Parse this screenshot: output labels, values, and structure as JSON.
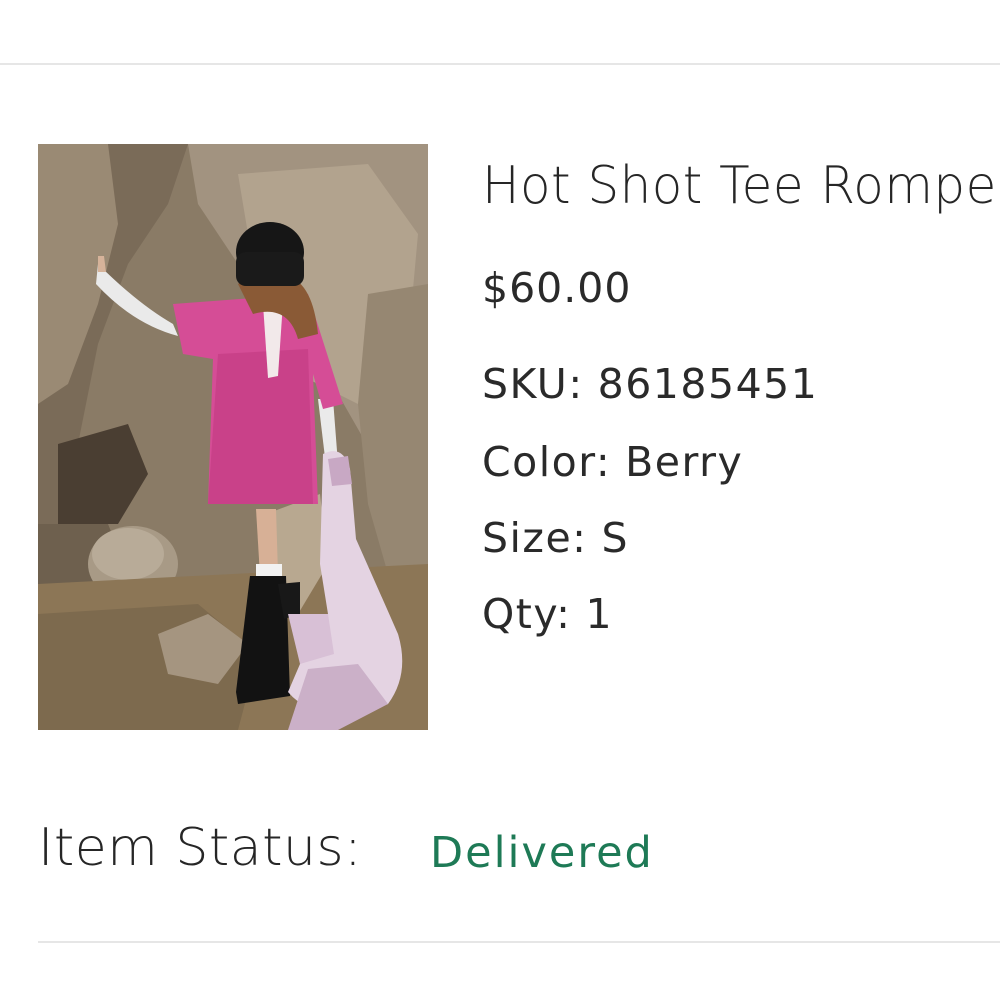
{
  "product": {
    "title": "Hot Shot Tee Romper",
    "price": "$60.00",
    "image_alt": "Model in berry romper climbing rocks",
    "attributes": [
      {
        "label": "SKU:",
        "value": "86185451"
      },
      {
        "label": "Color:",
        "value": "Berry"
      },
      {
        "label": "Size:",
        "value": "S"
      },
      {
        "label": "Qty:",
        "value": "1"
      }
    ]
  },
  "status": {
    "label": "Item Status:",
    "value": "Delivered"
  },
  "colors": {
    "status_delivered": "#1e7a56",
    "divider": "#e6e6e6"
  }
}
